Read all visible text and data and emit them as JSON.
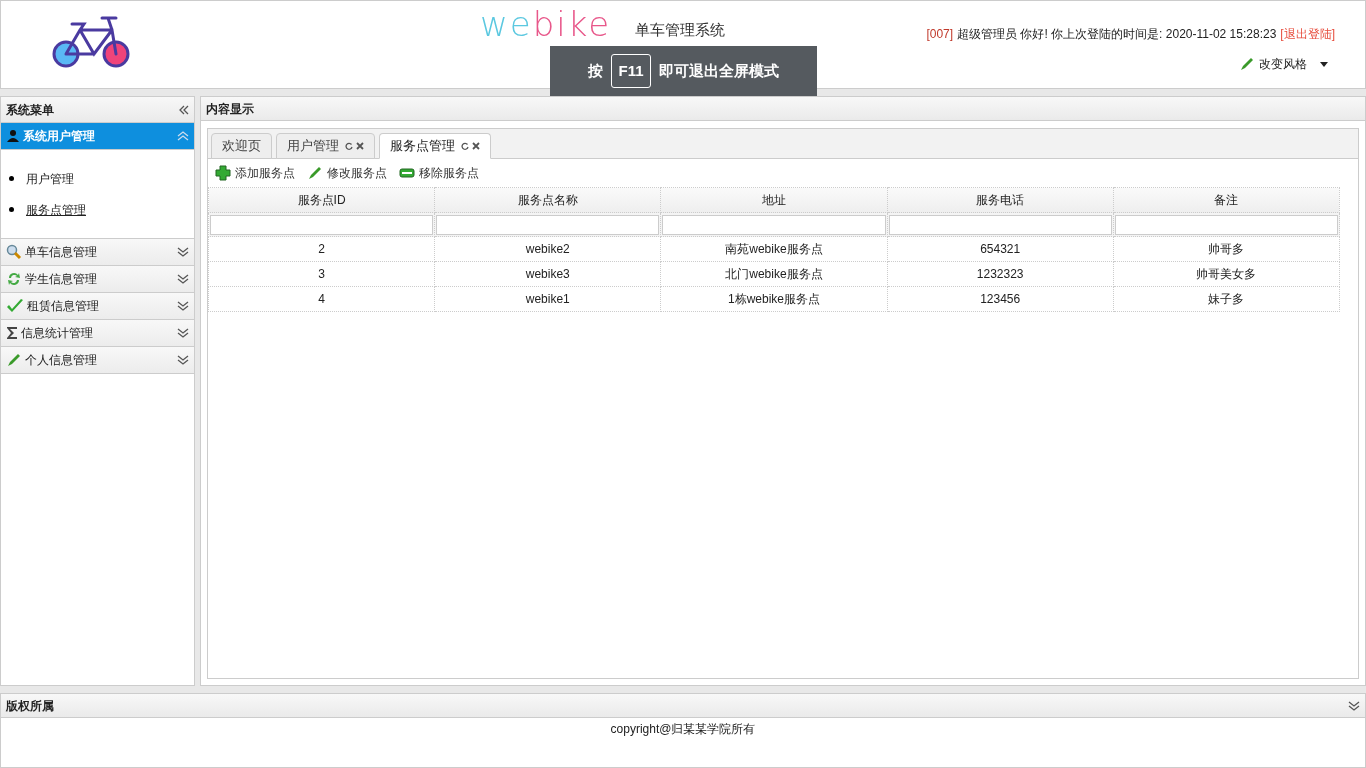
{
  "header": {
    "logo_parts": [
      {
        "text": "we",
        "color": "#5bc8e0"
      },
      {
        "text": "bike",
        "color": "#e8578a"
      }
    ],
    "subtitle": "单车管理系统",
    "user_id": "[007]",
    "greeting": "超级管理员 你好! 你上次登陆的时间是: 2020-11-02 15:28:23",
    "logout": "[退出登陆]",
    "theme_button": "改变风格"
  },
  "fullscreen_notice": {
    "prefix": "按",
    "key": "F11",
    "suffix": "即可退出全屏模式"
  },
  "sidebar": {
    "title": "系统菜单",
    "sections": [
      {
        "label": "系统用户管理",
        "expanded": true,
        "children": [
          {
            "label": "用户管理",
            "selected": false
          },
          {
            "label": "服务点管理",
            "selected": true
          }
        ]
      },
      {
        "label": "单车信息管理",
        "expanded": false
      },
      {
        "label": "学生信息管理",
        "expanded": false
      },
      {
        "label": "租赁信息管理",
        "expanded": false
      },
      {
        "label": "信息统计管理",
        "expanded": false
      },
      {
        "label": "个人信息管理",
        "expanded": false
      }
    ]
  },
  "content": {
    "title": "内容显示",
    "tabs": [
      {
        "label": "欢迎页",
        "closable": false,
        "selected": false
      },
      {
        "label": "用户管理",
        "closable": true,
        "selected": false
      },
      {
        "label": "服务点管理",
        "closable": true,
        "selected": true
      }
    ],
    "toolbar": [
      {
        "label": "添加服务点"
      },
      {
        "label": "修改服务点"
      },
      {
        "label": "移除服务点"
      }
    ],
    "table": {
      "columns": [
        "服务点ID",
        "服务点名称",
        "地址",
        "服务电话",
        "备注"
      ],
      "rows": [
        [
          "2",
          "webike2",
          "南苑webike服务点",
          "654321",
          "帅哥多"
        ],
        [
          "3",
          "webike3",
          "北门webike服务点",
          "1232323",
          "帅哥美女多"
        ],
        [
          "4",
          "webike1",
          "1栋webike服务点",
          "123456",
          "妹子多"
        ]
      ]
    }
  },
  "footer": {
    "title": "版权所属",
    "text": "copyright@归某某学院所有"
  }
}
